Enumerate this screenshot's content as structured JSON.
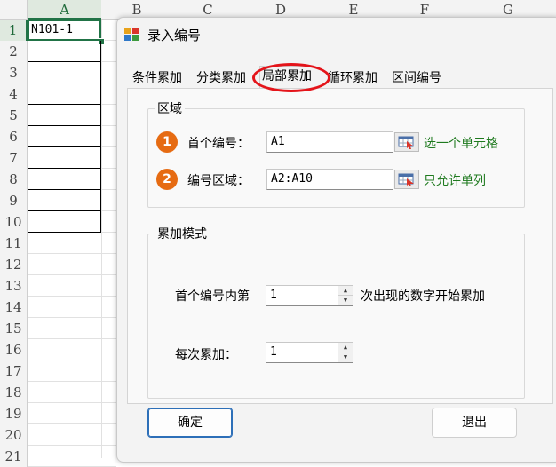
{
  "sheet": {
    "columns": [
      "A",
      "B",
      "C",
      "D",
      "E",
      "F",
      "G"
    ],
    "rows": [
      "1",
      "2",
      "3",
      "4",
      "5",
      "6",
      "7",
      "8",
      "9",
      "10",
      "11",
      "12",
      "13",
      "14",
      "15",
      "16",
      "17",
      "18",
      "19",
      "20",
      "21"
    ],
    "cell_a1": "N101-1"
  },
  "dialog": {
    "title": "录入编号",
    "tabs": [
      "条件累加",
      "分类累加",
      "局部累加",
      "循环累加",
      "区间编号"
    ],
    "active_tab": "局部累加",
    "region": {
      "label": "区域",
      "step1": "1",
      "step2": "2",
      "first_label": "首个编号：",
      "first_value": "A1",
      "first_hint": "选一个单元格",
      "range_label": "编号区域：",
      "range_value": "A2:A10",
      "range_hint": "只允许单列"
    },
    "mode": {
      "label": "累加模式",
      "start_prefix": "首个编号内第",
      "start_value": "1",
      "start_suffix": "次出现的数字开始累加",
      "step_label": "每次累加：",
      "step_value": "1"
    },
    "ok_label": "确定",
    "exit_label": "退出"
  },
  "colors": {
    "accent": "#217346",
    "badge": "#e66b12",
    "hint": "#1f7a1f",
    "highlight_ring": "#e4141a"
  }
}
